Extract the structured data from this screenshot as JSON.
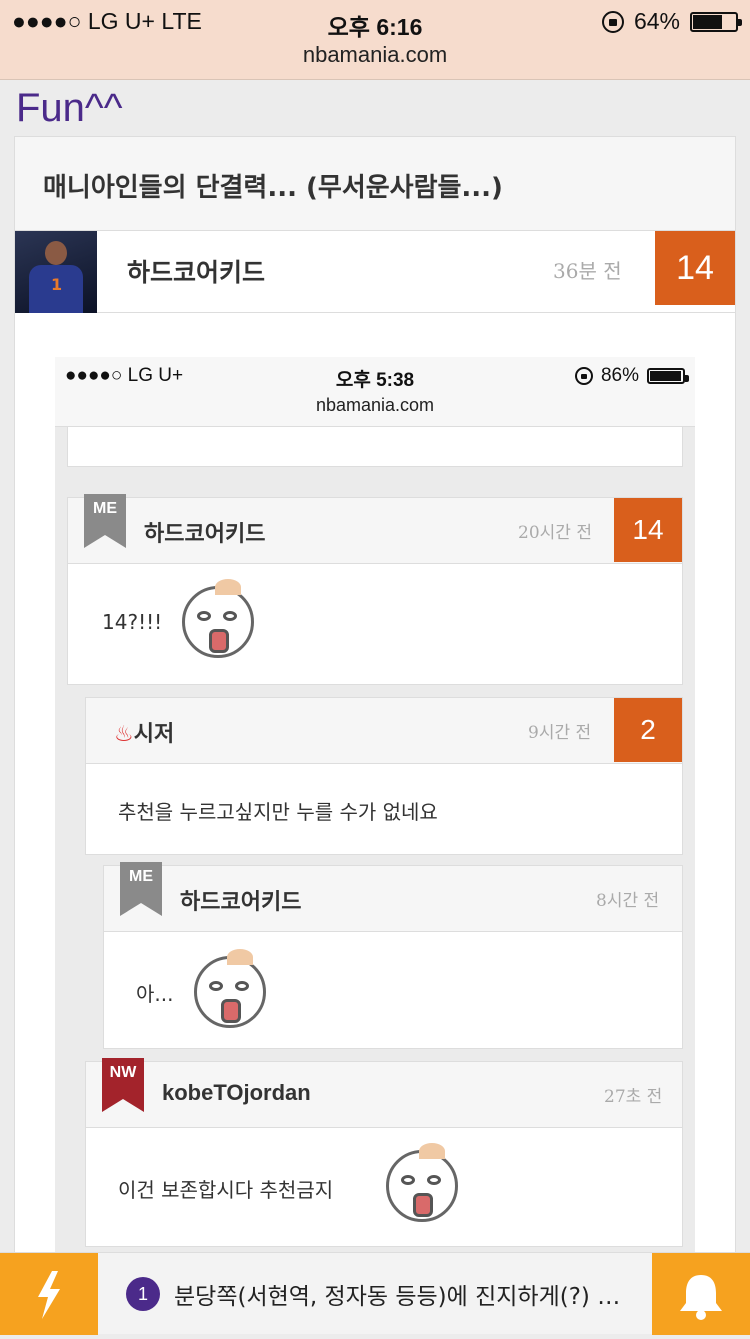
{
  "status_bar": {
    "carrier": "●●●●○ LG U+   LTE",
    "time": "오후 6:16",
    "battery": "64%",
    "battery_level": 0.64,
    "url": "nbamania.com"
  },
  "section_title": "Fun^^",
  "post": {
    "title": "매니아인들의 단결력... (무서운사람들...)",
    "author": "하드코어키드",
    "time": "36분 전",
    "recommend_count": "14"
  },
  "inner_screenshot": {
    "status_bar": {
      "carrier": "●●●●○ LG U+",
      "time": "오후 5:38",
      "battery": "86%",
      "battery_level": 0.86,
      "url": "nbamania.com"
    },
    "comments": [
      {
        "badge": "ME",
        "author": "하드코어키드",
        "time": "20시간 전",
        "count": "14",
        "body": "14?!!!"
      },
      {
        "badge": "♨",
        "author": "시저",
        "time": "9시간 전",
        "count": "2",
        "body": "추천을 누르고싶지만 누를 수가 없네요"
      },
      {
        "badge": "ME",
        "author": "하드코어키드",
        "time": "8시간 전",
        "body": "아..."
      },
      {
        "badge": "NW",
        "author": "kobeTOjordan",
        "time": "27초 전",
        "body": "이건 보존합시다 추천금지"
      }
    ]
  },
  "bottom_bar": {
    "ticker_number": "1",
    "ticker_text": "분당쪽(서현역, 정자동 등등)에 진지하게(?) …"
  },
  "colors": {
    "accent": "#d95f1c",
    "purple": "#4b2a8a",
    "status_bg": "#f6dccd",
    "bottom_orange": "#f6a21f"
  }
}
